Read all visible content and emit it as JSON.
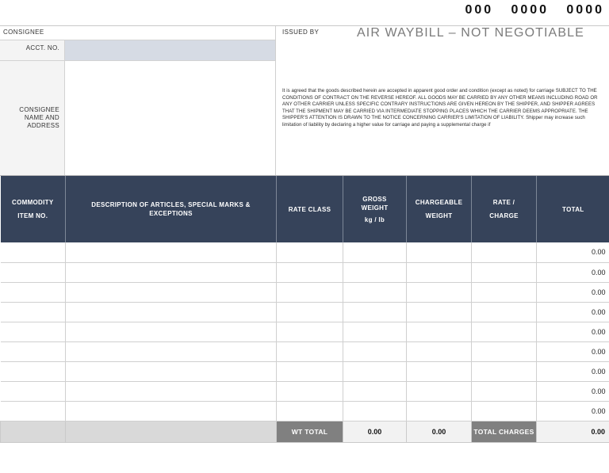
{
  "header": {
    "awb_number": "000   0000   0000",
    "document_title": "AIR WAYBILL – NOT NEGOTIABLE"
  },
  "consignee": {
    "section_label": "CONSIGNEE",
    "acct_no_label": "ACCT. NO.",
    "acct_no_value": "",
    "acct_no_placeholder": "",
    "name_address_label": "CONSIGNEE NAME AND ADDRESS",
    "name_address_value": "",
    "name_address_placeholder": ""
  },
  "issued_by": {
    "label": "ISSUED BY",
    "conditions_text": "It is agreed that the goods described herein are accepted in apparent good order and condition (except as noted) for carriage SUBJECT TO THE CONDITIONS OF CONTRACT ON THE REVERSE HEREOF. ALL GOODS MAY BE CARRIED BY ANY OTHER MEANS INCLUDING ROAD OR ANY OTHER CARRIER UNLESS SPECIFIC CONTRARY INSTRUCTIONS ARE GIVEN HEREON BY THE SHIPPER, AND SHIPPER AGREES THAT THE SHIPMENT MAY BE CARRIED VIA INTERMEDIATE STOPPING PLACES WHICH THE CARRIER DEEMS APPROPRIATE. THE SHIPPER'S ATTENTION IS DRAWN TO THE NOTICE CONCERNING CARRIER'S LIMITATION OF LIABILITY. Shipper may increase such limitation of liability by declaring a higher value for carriage and paying a supplemental charge if"
  },
  "table": {
    "columns": [
      {
        "line1": "COMMODITY",
        "line2": "ITEM NO."
      },
      {
        "line1": "DESCRIPTION OF ARTICLES, SPECIAL MARKS &",
        "line2": "EXCEPTIONS"
      },
      {
        "line1": "RATE CLASS",
        "line2": ""
      },
      {
        "line1": "GROSS",
        "line2": "WEIGHT",
        "line3": "kg / lb"
      },
      {
        "line1": "CHARGEABLE",
        "line2": "WEIGHT"
      },
      {
        "line1": "RATE /",
        "line2": "CHARGE"
      },
      {
        "line1": "TOTAL",
        "line2": ""
      }
    ],
    "rows": [
      {
        "commodity": "",
        "description": "",
        "rate_class": "",
        "gross_weight": "",
        "chargeable_weight": "",
        "rate_charge": "",
        "total": "0.00"
      },
      {
        "commodity": "",
        "description": "",
        "rate_class": "",
        "gross_weight": "",
        "chargeable_weight": "",
        "rate_charge": "",
        "total": "0.00"
      },
      {
        "commodity": "",
        "description": "",
        "rate_class": "",
        "gross_weight": "",
        "chargeable_weight": "",
        "rate_charge": "",
        "total": "0.00"
      },
      {
        "commodity": "",
        "description": "",
        "rate_class": "",
        "gross_weight": "",
        "chargeable_weight": "",
        "rate_charge": "",
        "total": "0.00"
      },
      {
        "commodity": "",
        "description": "",
        "rate_class": "",
        "gross_weight": "",
        "chargeable_weight": "",
        "rate_charge": "",
        "total": "0.00"
      },
      {
        "commodity": "",
        "description": "",
        "rate_class": "",
        "gross_weight": "",
        "chargeable_weight": "",
        "rate_charge": "",
        "total": "0.00"
      },
      {
        "commodity": "",
        "description": "",
        "rate_class": "",
        "gross_weight": "",
        "chargeable_weight": "",
        "rate_charge": "",
        "total": "0.00"
      },
      {
        "commodity": "",
        "description": "",
        "rate_class": "",
        "gross_weight": "",
        "chargeable_weight": "",
        "rate_charge": "",
        "total": "0.00"
      },
      {
        "commodity": "",
        "description": "",
        "rate_class": "",
        "gross_weight": "",
        "chargeable_weight": "",
        "rate_charge": "",
        "total": "0.00"
      }
    ],
    "totals": {
      "wt_total_label": "WT TOTAL",
      "gross_weight_total": "0.00",
      "chargeable_weight_total": "0.00",
      "total_charges_label": "TOTAL CHARGES",
      "total_charges_value": "0.00"
    }
  },
  "colors": {
    "header_bg": "#36435a",
    "field_bg": "#d6dbe4",
    "badge_bg": "#808080",
    "totals_bg": "#d9d9d9",
    "title_text": "#7b7b7b"
  }
}
